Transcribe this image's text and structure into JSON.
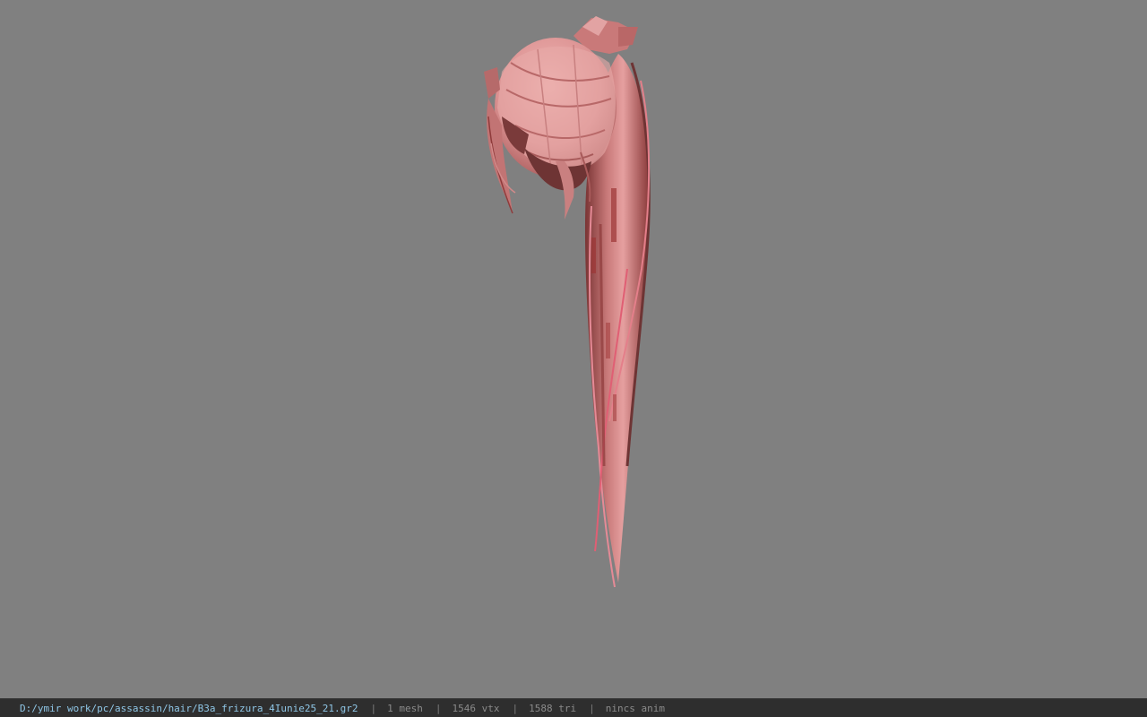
{
  "status_bar": {
    "file_path": "D:/ymir work/pc/assassin/hair/B3a_frizura_4Iunie25_21.gr2",
    "separator": "|",
    "mesh_count": "1 mesh",
    "vertex_count": "1546 vtx",
    "triangle_count": "1588 tri",
    "animation": "nincs anim"
  },
  "colors": {
    "viewport_background": "#808080",
    "status_bar_background": "#2e2e2e",
    "path_text": "#8fc6e6",
    "stat_text": "#8a8a8a",
    "hair_light": "#e9a6a6",
    "hair_mid": "#d68b8b",
    "hair_dark": "#8f3b3b",
    "hair_shadow": "#6e3434"
  },
  "viewport": {
    "model": "hair-mesh"
  }
}
